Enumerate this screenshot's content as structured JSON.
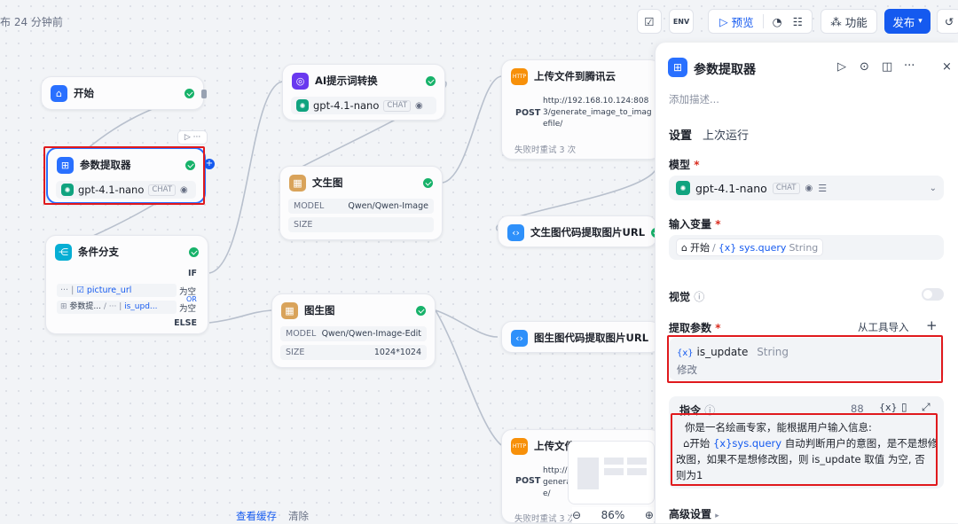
{
  "topbar": {
    "status": "布 24 分钟前",
    "preview": "预览",
    "features": "功能",
    "publish": "发布",
    "env": "ENV"
  },
  "nodes": {
    "start": {
      "title": "开始"
    },
    "param_extractor": {
      "title": "参数提取器",
      "model": "gpt-4.1-nano",
      "model_tag": "CHAT"
    },
    "condition": {
      "title": "条件分支",
      "if": "IF",
      "else": "ELSE",
      "or": "OR",
      "row1_var": "picture_url",
      "row1_op": "为空",
      "row2_src": "参数提...",
      "row2_var": "is_upd...",
      "row2_op": "为空"
    },
    "ai_prompt": {
      "title": "AI提示词转换",
      "model": "gpt-4.1-nano",
      "model_tag": "CHAT"
    },
    "text2img": {
      "title": "文生图",
      "model_key": "MODEL",
      "model_val": "Qwen/Qwen-Image",
      "size_key": "SIZE",
      "size_val": ""
    },
    "img2img": {
      "title": "图生图",
      "model_key": "MODEL",
      "model_val": "Qwen/Qwen-Image-Edit",
      "size_key": "SIZE",
      "size_val": "1024*1024"
    },
    "upload1": {
      "title": "上传文件到腾讯云",
      "method": "POST",
      "url": "http://192.168.10.124:8083/generate_image_to_imagefile/",
      "retry": "失败时重试 3 次"
    },
    "extract_text": {
      "title": "文生图代码提取图片URL"
    },
    "extract_img": {
      "title": "图生图代码提取图片URL"
    },
    "upload2": {
      "title": "上传文件",
      "method": "POST",
      "url_a": "http://",
      "url_b": "genera",
      "url_c": "e/",
      "retry": "失败时重试 3 次"
    }
  },
  "canvas": {
    "view_cache": "查看缓存",
    "clear": "清除",
    "zoom": "86%"
  },
  "panel": {
    "title": "参数提取器",
    "desc_placeholder": "添加描述...",
    "tabs": [
      "设置",
      "上次运行"
    ],
    "model_label": "模型",
    "model": "gpt-4.1-nano",
    "model_tag": "CHAT",
    "input_label": "输入变量",
    "input_node": "开始",
    "input_var": "sys.query",
    "input_type": "String",
    "vision_label": "视觉",
    "extract_label": "提取参数",
    "import_tools": "从工具导入",
    "param_name": "is_update",
    "param_type": "String",
    "param_desc": "修改",
    "instruction_label": "指令",
    "instruction_count": "88",
    "instruction_line1": "你是一名绘画专家，能根据用户输入信息:",
    "instruction_node": "开始",
    "instruction_var": "sys.query",
    "instruction_line2": "自动判断用户的意图，是不是想修",
    "instruction_line3": "改图，如果不是想修改图，则 is_update 取值 为空, 否",
    "instruction_line4": "则为1",
    "advanced": "高级设置"
  },
  "colors": {
    "accent": "#155aef",
    "success": "#17b26a",
    "highlight": "#e0191d"
  }
}
